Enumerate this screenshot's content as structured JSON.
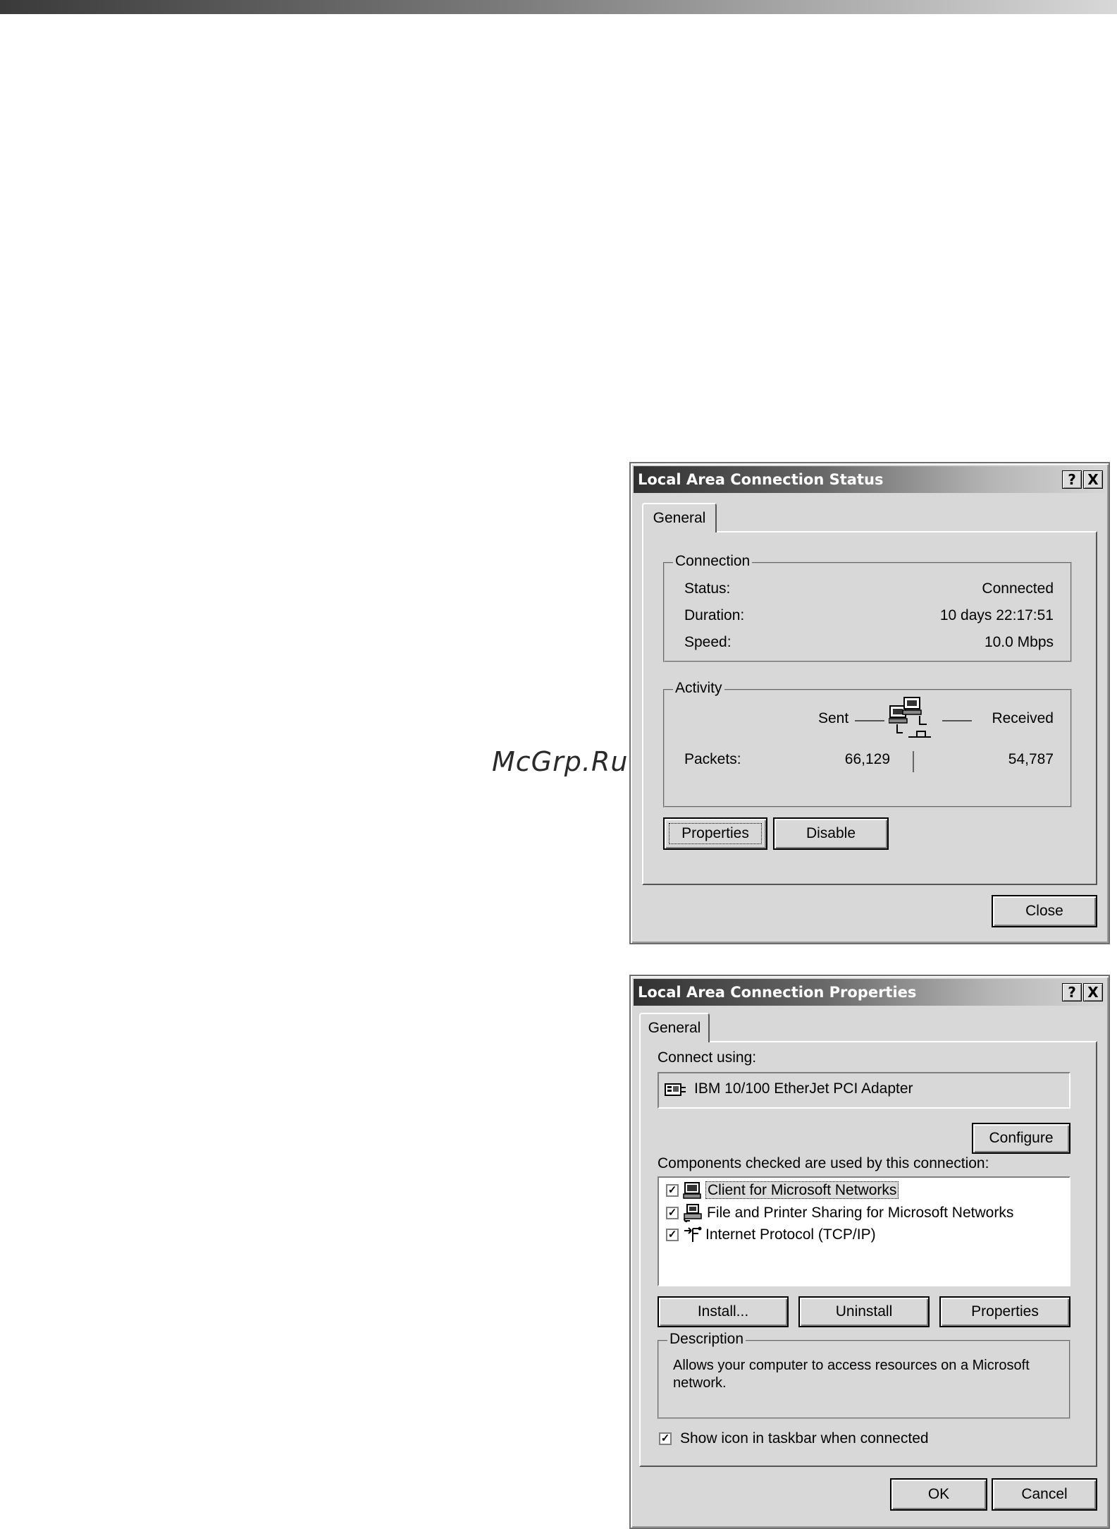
{
  "watermark": "McGrp.Ru",
  "status_dialog": {
    "title": "Local Area Connection Status",
    "help_button": "?",
    "close_x": "X",
    "tab": "General",
    "connection": {
      "group_title": "Connection",
      "status_label": "Status:",
      "status_value": "Connected",
      "duration_label": "Duration:",
      "duration_value": "10 days 22:17:51",
      "speed_label": "Speed:",
      "speed_value": "10.0 Mbps"
    },
    "activity": {
      "group_title": "Activity",
      "sent_label": "Sent",
      "received_label": "Received",
      "packets_label": "Packets:",
      "packets_sent": "66,129",
      "packets_received": "54,787"
    },
    "properties_button": "Properties",
    "disable_button": "Disable",
    "close_button": "Close"
  },
  "properties_dialog": {
    "title": "Local Area Connection Properties",
    "help_button": "?",
    "close_x": "X",
    "tab": "General",
    "connect_using_label": "Connect using:",
    "adapter_name": "IBM 10/100 EtherJet PCI Adapter",
    "configure_button": "Configure",
    "components_label": "Components checked are used by this connection:",
    "components": [
      {
        "label": "Client for Microsoft Networks",
        "checked": true,
        "icon": "computer-icon"
      },
      {
        "label": "File and Printer Sharing for Microsoft Networks",
        "checked": true,
        "icon": "printer-share-icon"
      },
      {
        "label": "Internet Protocol (TCP/IP)",
        "checked": true,
        "icon": "network-protocol-icon"
      }
    ],
    "install_button": "Install...",
    "uninstall_button": "Uninstall",
    "properties_button": "Properties",
    "description": {
      "group_title": "Description",
      "text": "Allows your computer to access resources on a Microsoft network."
    },
    "show_icon_label": "Show icon in taskbar when connected",
    "show_icon_checked": true,
    "ok_button": "OK",
    "cancel_button": "Cancel"
  }
}
